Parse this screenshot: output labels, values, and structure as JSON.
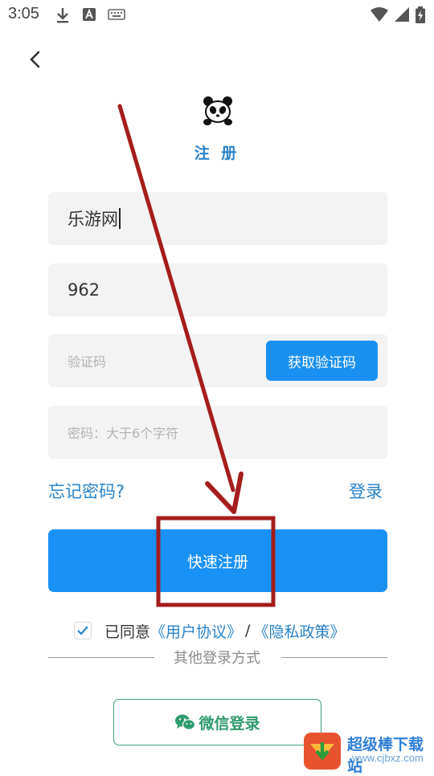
{
  "status_bar": {
    "time": "3:05",
    "icons": [
      "download-icon",
      "a-icon",
      "keyboard-icon",
      "wifi-icon",
      "signal-icon",
      "battery-icon"
    ]
  },
  "header": {
    "title": "注 册",
    "back_icon": "back-arrow-icon",
    "logo_icon": "panda-logo-icon"
  },
  "form": {
    "username_value": "乐游网",
    "phone_value": "962",
    "code_placeholder": "验证码",
    "get_code_label": "获取验证码",
    "password_placeholder": "密码：大于6个字符"
  },
  "links": {
    "forgot_password": "忘记密码?",
    "login": "登录"
  },
  "register_button": "快速注册",
  "agreement": {
    "checked": true,
    "prefix": "已同意",
    "user_agreement": "《用户协议》",
    "separator": "/",
    "privacy_policy": "《隐私政策》"
  },
  "other_login": {
    "divider_text": "其他登录方式",
    "wechat_label": "微信登录",
    "wechat_icon": "wechat-icon"
  },
  "watermark": {
    "text": "超级棒下载站",
    "url": "www.cjbxz.com"
  },
  "colors": {
    "accent": "#1a91f5",
    "link": "#2a84c9",
    "wechat": "#2f9a6e",
    "annotation": "#a51d1d"
  }
}
